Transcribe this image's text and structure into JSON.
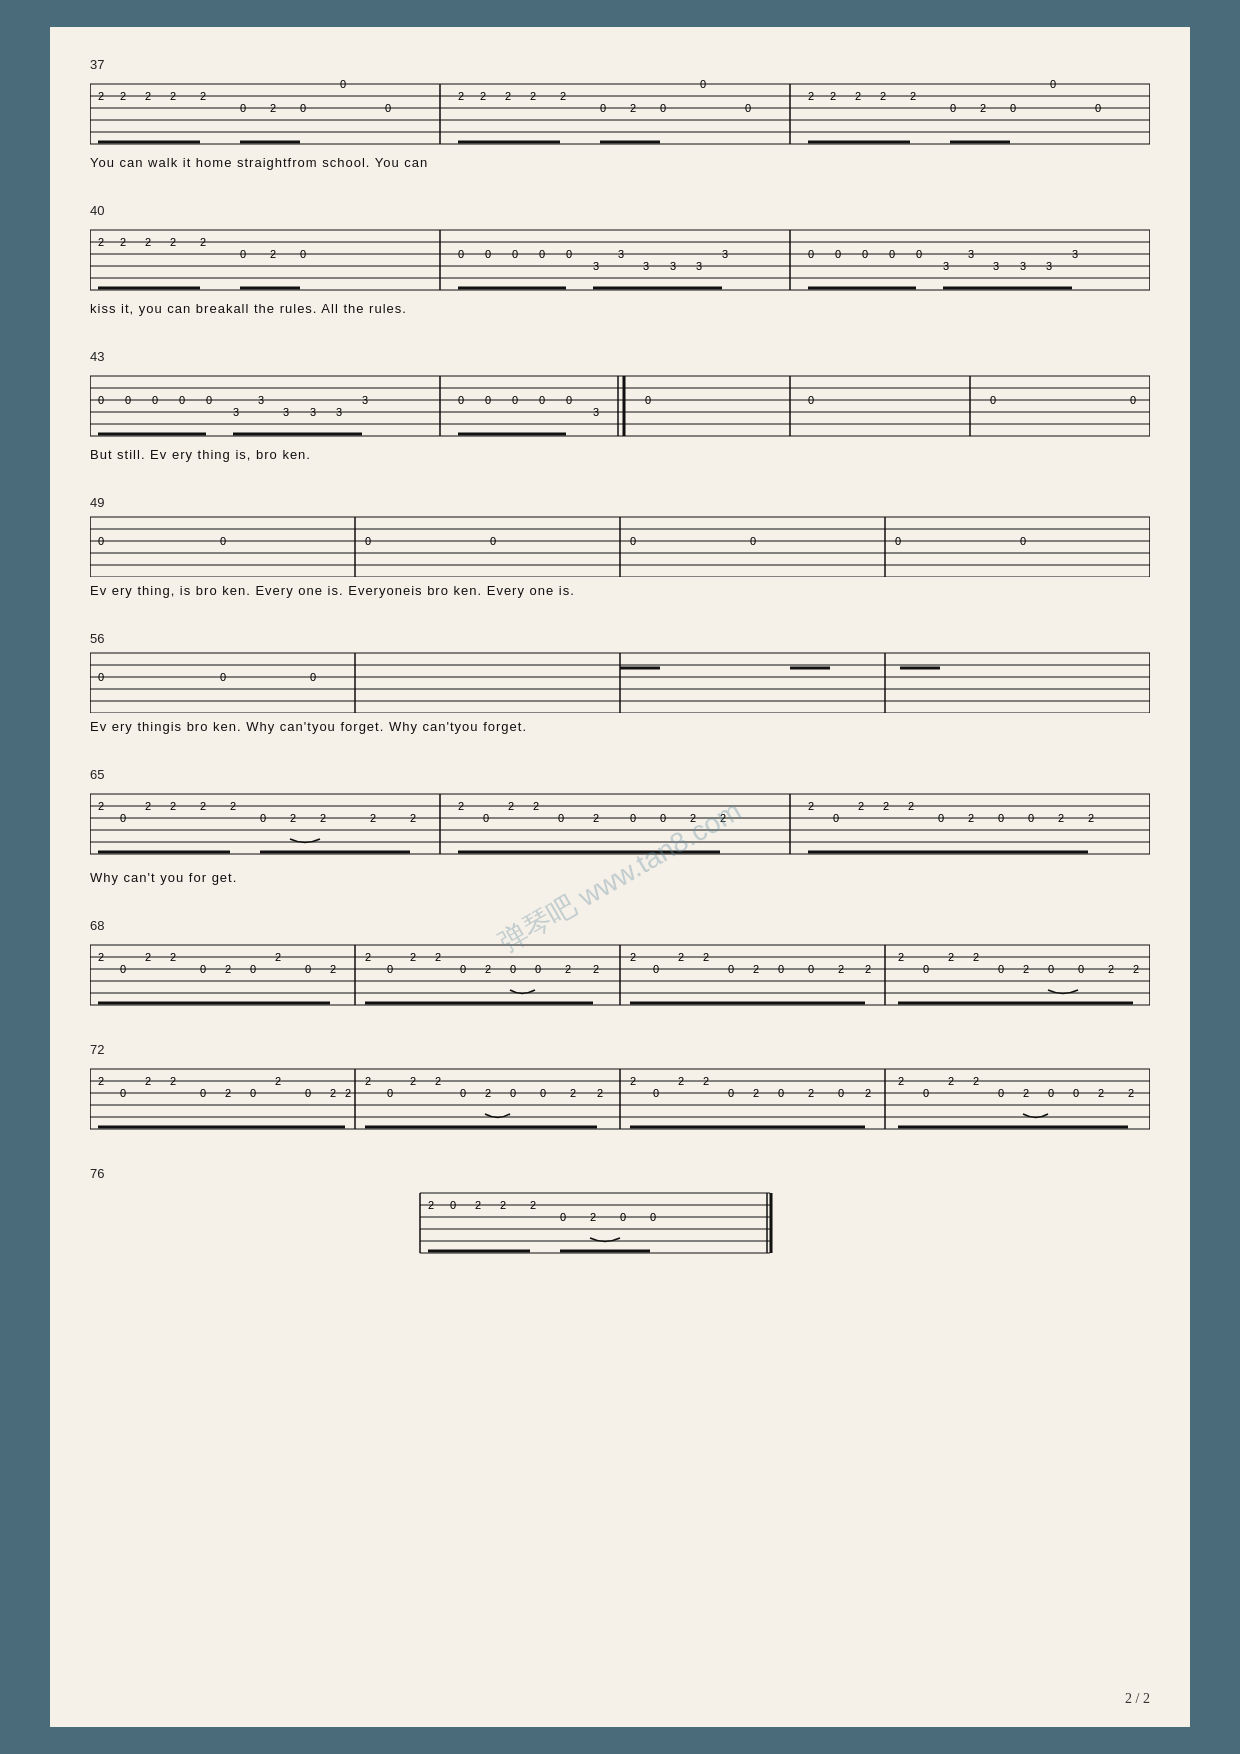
{
  "page": {
    "background": "#4a6b7a",
    "sheet_background": "#f5f0e8",
    "watermark": "弹琴吧 www.tan8.com",
    "page_number": "2 / 2",
    "sections": [
      {
        "id": "s37",
        "measure_start": 37,
        "lyrics": "You can   walk it   home   straightfrom     school.                                   You can"
      },
      {
        "id": "s40",
        "measure_start": 40,
        "lyrics": "kiss it,  you can  breakall   the  rules.                                  All        the    rules."
      },
      {
        "id": "s43",
        "measure_start": 43,
        "lyrics": "                         But  still.      Ev ery thing is,                        bro ken."
      },
      {
        "id": "s49",
        "measure_start": 49,
        "lyrics": "Ev ery thing, is                bro ken.    Every one is.       Everyoneis        bro ken.     Every one is."
      },
      {
        "id": "s56",
        "measure_start": 56,
        "lyrics": "Ev ery thingis           bro ken.             Why can'tyou forget.                Why can'tyou forget."
      },
      {
        "id": "s65",
        "measure_start": 65,
        "lyrics": "                  Why   can't you   for  get."
      },
      {
        "id": "s68",
        "measure_start": 68,
        "lyrics": ""
      },
      {
        "id": "s72",
        "measure_start": 72,
        "lyrics": ""
      },
      {
        "id": "s76",
        "measure_start": 76,
        "lyrics": ""
      }
    ]
  }
}
